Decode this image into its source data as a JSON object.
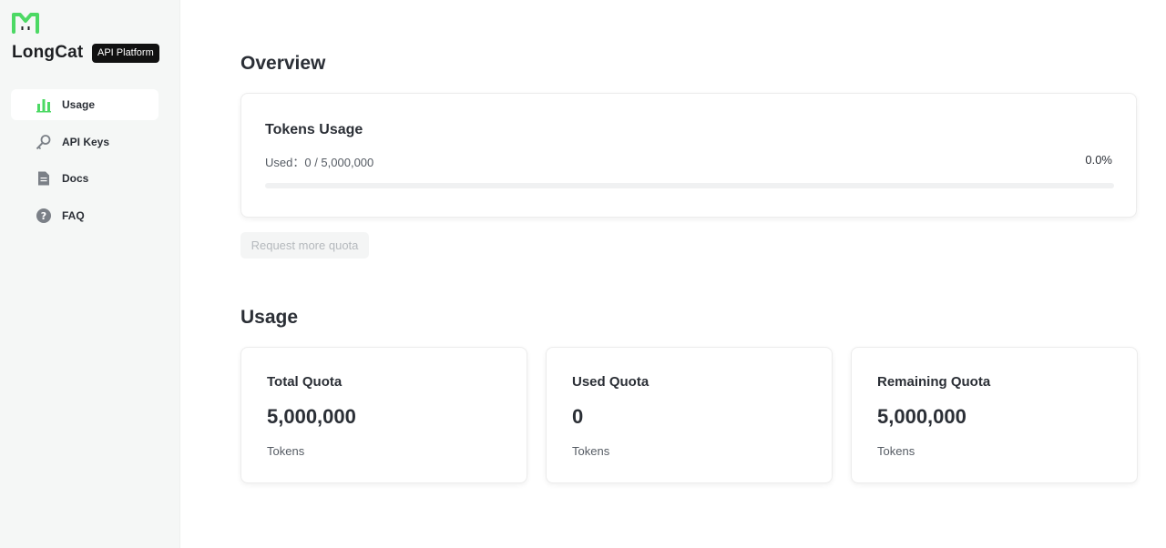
{
  "brand": {
    "name": "LongCat",
    "badge": "API Platform",
    "accent": "#4cd964"
  },
  "sidebar": {
    "items": [
      {
        "label": "Usage",
        "icon": "bar-chart-icon",
        "active": true
      },
      {
        "label": "API Keys",
        "icon": "key-icon",
        "active": false
      },
      {
        "label": "Docs",
        "icon": "document-icon",
        "active": false
      },
      {
        "label": "FAQ",
        "icon": "question-icon",
        "active": false
      }
    ]
  },
  "overview": {
    "title": "Overview",
    "tokens_usage": {
      "title": "Tokens Usage",
      "used_label": "Used：",
      "used_value": "0 / 5,000,000",
      "percent": "0.0%",
      "progress_fraction": 0
    },
    "request_button": "Request more quota"
  },
  "usage": {
    "title": "Usage",
    "cards": [
      {
        "title": "Total Quota",
        "value": "5,000,000",
        "unit": "Tokens"
      },
      {
        "title": "Used Quota",
        "value": "0",
        "unit": "Tokens"
      },
      {
        "title": "Remaining Quota",
        "value": "5,000,000",
        "unit": "Tokens"
      }
    ]
  }
}
